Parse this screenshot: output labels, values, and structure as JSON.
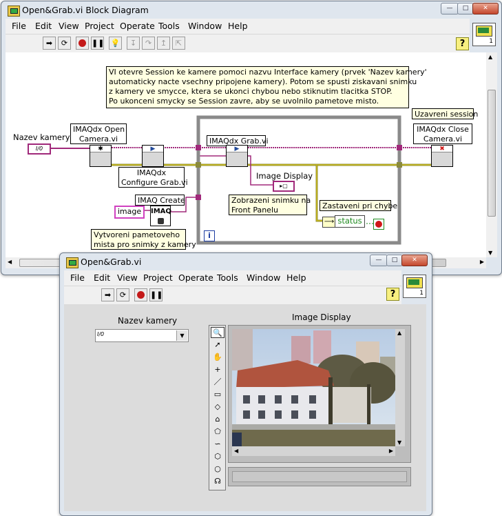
{
  "block_diagram": {
    "title": "Open&Grab.vi Block Diagram",
    "menu": [
      "File",
      "Edit",
      "View",
      "Project",
      "Operate",
      "Tools",
      "Window",
      "Help"
    ],
    "help_glyph": "?",
    "connector_pane_number": "1",
    "comment_main": [
      "VI otevre Session ke kamere pomoci nazvu Interface kamery (prvek 'Nazev kamery'",
      "automaticky nacte vsechny pripojene kamery). Potom se spusti ziskavani snimku",
      "z kamery ve smycce, ktera se ukonci chybou nebo stiknutim tlacitka STOP.",
      "Po ukonceni smycky se Session zavre, aby se uvolnilo pametove misto."
    ],
    "control_label": "Nazev kamery",
    "control_terminal_text": "I/0",
    "open_label": [
      "IMAQdx Open",
      "Camera.vi"
    ],
    "configure_label": [
      "IMAQdx",
      "Configure Grab.vi"
    ],
    "create_label": "IMAQ Create",
    "create_icon_text": "IMAQ",
    "image_constant": "image",
    "alloc_comment": [
      "Vytvoreni pametoveho",
      "mista pro snimky z kamery"
    ],
    "grab_label": "IMAQdx Grab.vi",
    "image_display_label": "Image Display",
    "display_comment": [
      "Zobrazeni snimku na",
      "Front Panelu"
    ],
    "stop_comment": "Zastaveni pri chybe",
    "status_text": "status",
    "close_comment": "Uzavreni session",
    "close_label": [
      "IMAQdx Close",
      "Camera.vi"
    ],
    "loop_iteration": "i"
  },
  "front_panel": {
    "title": "Open&Grab.vi",
    "menu": [
      "File",
      "Edit",
      "View",
      "Project",
      "Operate",
      "Tools",
      "Window",
      "Help"
    ],
    "help_glyph": "?",
    "connector_pane_number": "1",
    "camera_label": "Nazev kamery",
    "camera_value": "",
    "camera_prefix": "I/0",
    "display_label": "Image Display"
  },
  "colors": {
    "wire_pink": "#a0287a",
    "wire_olive": "#8a8a3c",
    "wire_yellow": "#e8d000",
    "wire_green": "#1d8a1d",
    "loop_frame": "#8a8a8a",
    "stop_red": "#d01818"
  },
  "icons": [
    "run-arrow-icon",
    "run-continuous-icon",
    "abort-icon",
    "pause-icon",
    "highlight-bulb-icon",
    "step-into-icon",
    "step-over-icon",
    "step-out-icon",
    "zoom-tool-icon",
    "pointer-tool-icon",
    "pan-tool-icon",
    "point-tool-icon",
    "line-tool-icon",
    "rectangle-tool-icon",
    "rotated-rect-tool-icon",
    "annulus-tool-icon",
    "polygon-tool-icon",
    "freehand-tool-icon",
    "broken-line-tool-icon",
    "oval-tool-icon",
    "freeline-tool-icon"
  ]
}
